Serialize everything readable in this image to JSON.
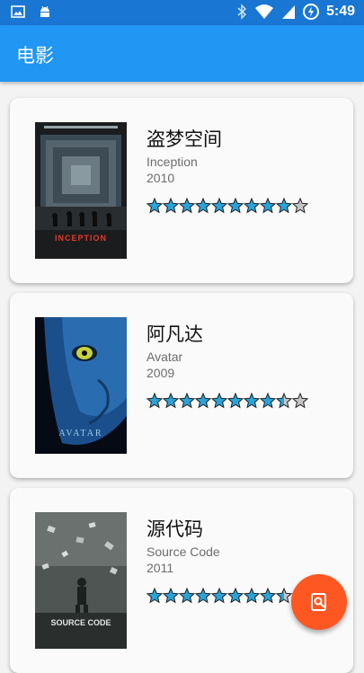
{
  "status_bar": {
    "time": "5:49",
    "left_icons": [
      "image-icon",
      "android-icon"
    ],
    "right_icons": [
      "bluetooth-icon",
      "wifi-icon",
      "signal-icon",
      "battery-icon"
    ]
  },
  "app_bar": {
    "title": "电影"
  },
  "movies": [
    {
      "title_cn": "盗梦空间",
      "title_en": "Inception",
      "year": "2010",
      "rating": 4.5,
      "max_rating": 5,
      "poster_text": "INCEPTION"
    },
    {
      "title_cn": "阿凡达",
      "title_en": "Avatar",
      "year": "2009",
      "rating": 4.25,
      "max_rating": 5,
      "poster_text": "AVATAR"
    },
    {
      "title_cn": "源代码",
      "title_en": "Source Code",
      "year": "2011",
      "rating": 4.25,
      "max_rating": 5,
      "poster_text": "SOURCE CODE"
    }
  ],
  "fab": {
    "icon": "search-icon"
  },
  "colors": {
    "primary": "#2196f3",
    "status_bar": "#1976d2",
    "accent": "#ff5722",
    "star": "#29a3d9"
  }
}
